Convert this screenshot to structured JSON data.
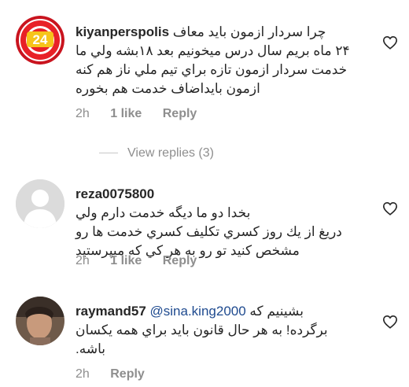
{
  "comments": [
    {
      "username": "kiyanperspolis",
      "first_line": "چرا سردار ازمون باید معاف",
      "lines": [
        "۲۴ ماه بریم سال درس میخونیم بعد ۱۸بشه ولي ما",
        "خدمت سردار ازمون تازه براي تيم ملي ناز هم كنه",
        "ازمون بايداضاف خدمت هم بخوره"
      ],
      "time": "2h",
      "likes": "1 like",
      "reply": "Reply",
      "avatar_badge": "24"
    },
    {
      "username": "reza0075800",
      "first_line": "",
      "lines": [
        "بخدا دو ما ديگه خدمت دارم ولي",
        "دريغ از يك روز كسري تكليف كسري خدمت ها رو",
        "مشخص كنيد تو رو به هر كي كه ميپرستيد"
      ],
      "time": "2h",
      "likes": "1 like",
      "reply": "Reply"
    },
    {
      "username": "raymand57",
      "mention": "@sina.king2000",
      "first_line": "بشينيم كه",
      "lines": [
        "برگرده! به هر حال قانون بايد براي همه يكسان",
        "باشه."
      ],
      "time": "2h",
      "reply": "Reply"
    }
  ],
  "view_replies": "View replies (3)",
  "colors": {
    "text": "#262626",
    "meta": "#8e8e8e",
    "mention": "#1e4a8f"
  }
}
